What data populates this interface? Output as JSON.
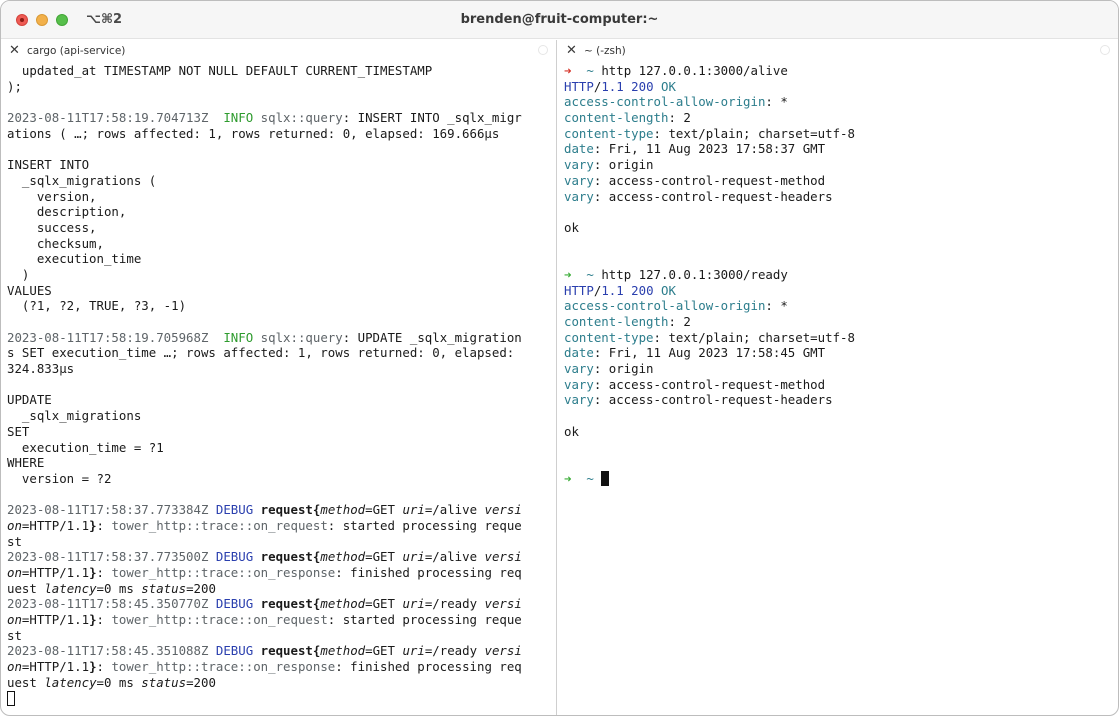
{
  "window": {
    "shortcut": "⌥⌘2",
    "title": "brenden@fruit-computer:~"
  },
  "left_pane": {
    "tab_label": "cargo (api-service)",
    "lines": [
      [
        {
          "t": "  updated_at TIMESTAMP NOT NULL DEFAULT CURRENT_TIMESTAMP"
        }
      ],
      [
        {
          "t": ");"
        }
      ],
      [
        {
          "t": ""
        }
      ],
      [
        {
          "t": "2023-08-11T17:58:19.704713Z",
          "c": "grey"
        },
        {
          "t": "  "
        },
        {
          "t": "INFO",
          "c": "green"
        },
        {
          "t": " "
        },
        {
          "t": "sqlx::query",
          "c": "grey"
        },
        {
          "t": ": INSERT INTO _sqlx_migr"
        }
      ],
      [
        {
          "t": "ations ( …; rows affected: 1, rows returned: 0, elapsed: 169.666µs"
        }
      ],
      [
        {
          "t": ""
        }
      ],
      [
        {
          "t": "INSERT INTO"
        }
      ],
      [
        {
          "t": "  _sqlx_migrations ("
        }
      ],
      [
        {
          "t": "    version,"
        }
      ],
      [
        {
          "t": "    description,"
        }
      ],
      [
        {
          "t": "    success,"
        }
      ],
      [
        {
          "t": "    checksum,"
        }
      ],
      [
        {
          "t": "    execution_time"
        }
      ],
      [
        {
          "t": "  )"
        }
      ],
      [
        {
          "t": "VALUES"
        }
      ],
      [
        {
          "t": "  (?1, ?2, TRUE, ?3, -1)"
        }
      ],
      [
        {
          "t": ""
        }
      ],
      [
        {
          "t": "2023-08-11T17:58:19.705968Z",
          "c": "grey"
        },
        {
          "t": "  "
        },
        {
          "t": "INFO",
          "c": "green"
        },
        {
          "t": " "
        },
        {
          "t": "sqlx::query",
          "c": "grey"
        },
        {
          "t": ": UPDATE _sqlx_migration"
        }
      ],
      [
        {
          "t": "s SET execution_time …; rows affected: 1, rows returned: 0, elapsed:"
        }
      ],
      [
        {
          "t": "324.833µs"
        }
      ],
      [
        {
          "t": ""
        }
      ],
      [
        {
          "t": "UPDATE"
        }
      ],
      [
        {
          "t": "  _sqlx_migrations"
        }
      ],
      [
        {
          "t": "SET"
        }
      ],
      [
        {
          "t": "  execution_time = ?1"
        }
      ],
      [
        {
          "t": "WHERE"
        }
      ],
      [
        {
          "t": "  version = ?2"
        }
      ],
      [
        {
          "t": ""
        }
      ],
      [
        {
          "t": "2023-08-11T17:58:37.773384Z",
          "c": "grey"
        },
        {
          "t": " "
        },
        {
          "t": "DEBUG",
          "c": "blue"
        },
        {
          "t": " "
        },
        {
          "t": "request{",
          "c": "bold"
        },
        {
          "t": "method",
          "c": "ital"
        },
        {
          "t": "=GET "
        },
        {
          "t": "uri",
          "c": "ital"
        },
        {
          "t": "=/alive "
        },
        {
          "t": "versi",
          "c": "ital"
        }
      ],
      [
        {
          "t": "on",
          "c": "ital"
        },
        {
          "t": "=HTTP/1.1"
        },
        {
          "t": "}",
          "c": "bold"
        },
        {
          "t": ": "
        },
        {
          "t": "tower_http::trace::on_request",
          "c": "grey"
        },
        {
          "t": ": started processing reque"
        }
      ],
      [
        {
          "t": "st"
        }
      ],
      [
        {
          "t": "2023-08-11T17:58:37.773500Z",
          "c": "grey"
        },
        {
          "t": " "
        },
        {
          "t": "DEBUG",
          "c": "blue"
        },
        {
          "t": " "
        },
        {
          "t": "request{",
          "c": "bold"
        },
        {
          "t": "method",
          "c": "ital"
        },
        {
          "t": "=GET "
        },
        {
          "t": "uri",
          "c": "ital"
        },
        {
          "t": "=/alive "
        },
        {
          "t": "versi",
          "c": "ital"
        }
      ],
      [
        {
          "t": "on",
          "c": "ital"
        },
        {
          "t": "=HTTP/1.1"
        },
        {
          "t": "}",
          "c": "bold"
        },
        {
          "t": ": "
        },
        {
          "t": "tower_http::trace::on_response",
          "c": "grey"
        },
        {
          "t": ": finished processing req"
        }
      ],
      [
        {
          "t": "uest "
        },
        {
          "t": "latency",
          "c": "ital"
        },
        {
          "t": "=0 ms "
        },
        {
          "t": "status",
          "c": "ital"
        },
        {
          "t": "=200"
        }
      ],
      [
        {
          "t": "2023-08-11T17:58:45.350770Z",
          "c": "grey"
        },
        {
          "t": " "
        },
        {
          "t": "DEBUG",
          "c": "blue"
        },
        {
          "t": " "
        },
        {
          "t": "request{",
          "c": "bold"
        },
        {
          "t": "method",
          "c": "ital"
        },
        {
          "t": "=GET "
        },
        {
          "t": "uri",
          "c": "ital"
        },
        {
          "t": "=/ready "
        },
        {
          "t": "versi",
          "c": "ital"
        }
      ],
      [
        {
          "t": "on",
          "c": "ital"
        },
        {
          "t": "=HTTP/1.1"
        },
        {
          "t": "}",
          "c": "bold"
        },
        {
          "t": ": "
        },
        {
          "t": "tower_http::trace::on_request",
          "c": "grey"
        },
        {
          "t": ": started processing reque"
        }
      ],
      [
        {
          "t": "st"
        }
      ],
      [
        {
          "t": "2023-08-11T17:58:45.351088Z",
          "c": "grey"
        },
        {
          "t": " "
        },
        {
          "t": "DEBUG",
          "c": "blue"
        },
        {
          "t": " "
        },
        {
          "t": "request{",
          "c": "bold"
        },
        {
          "t": "method",
          "c": "ital"
        },
        {
          "t": "=GET "
        },
        {
          "t": "uri",
          "c": "ital"
        },
        {
          "t": "=/ready "
        },
        {
          "t": "versi",
          "c": "ital"
        }
      ],
      [
        {
          "t": "on",
          "c": "ital"
        },
        {
          "t": "=HTTP/1.1"
        },
        {
          "t": "}",
          "c": "bold"
        },
        {
          "t": ": "
        },
        {
          "t": "tower_http::trace::on_response",
          "c": "grey"
        },
        {
          "t": ": finished processing req"
        }
      ],
      [
        {
          "t": "uest "
        },
        {
          "t": "latency",
          "c": "ital"
        },
        {
          "t": "=0 ms "
        },
        {
          "t": "status",
          "c": "ital"
        },
        {
          "t": "=200"
        }
      ],
      [
        {
          "cursor": "hollow"
        }
      ]
    ]
  },
  "right_pane": {
    "tab_label": "~ (-zsh)",
    "lines": [
      [
        {
          "t": "➜",
          "c": "arrow-red"
        },
        {
          "t": "  "
        },
        {
          "t": "~",
          "c": "teal"
        },
        {
          "t": " http 127.0.0.1:3000/alive"
        }
      ],
      [
        {
          "t": "HTTP",
          "c": "blue"
        },
        {
          "t": "/"
        },
        {
          "t": "1.1",
          "c": "blue"
        },
        {
          "t": " "
        },
        {
          "t": "200",
          "c": "blue"
        },
        {
          "t": " "
        },
        {
          "t": "OK",
          "c": "teal"
        }
      ],
      [
        {
          "t": "access-control-allow-origin",
          "c": "teal"
        },
        {
          "t": ": *"
        }
      ],
      [
        {
          "t": "content-length",
          "c": "teal"
        },
        {
          "t": ": 2"
        }
      ],
      [
        {
          "t": "content-type",
          "c": "teal"
        },
        {
          "t": ": text/plain; charset=utf-8"
        }
      ],
      [
        {
          "t": "date",
          "c": "teal"
        },
        {
          "t": ": Fri, 11 Aug 2023 17:58:37 GMT"
        }
      ],
      [
        {
          "t": "vary",
          "c": "teal"
        },
        {
          "t": ": origin"
        }
      ],
      [
        {
          "t": "vary",
          "c": "teal"
        },
        {
          "t": ": access-control-request-method"
        }
      ],
      [
        {
          "t": "vary",
          "c": "teal"
        },
        {
          "t": ": access-control-request-headers"
        }
      ],
      [
        {
          "t": ""
        }
      ],
      [
        {
          "t": "ok"
        }
      ],
      [
        {
          "t": ""
        }
      ],
      [
        {
          "t": ""
        }
      ],
      [
        {
          "t": "➜",
          "c": "arrow-green"
        },
        {
          "t": "  "
        },
        {
          "t": "~",
          "c": "teal"
        },
        {
          "t": " http 127.0.0.1:3000/ready"
        }
      ],
      [
        {
          "t": "HTTP",
          "c": "blue"
        },
        {
          "t": "/"
        },
        {
          "t": "1.1",
          "c": "blue"
        },
        {
          "t": " "
        },
        {
          "t": "200",
          "c": "blue"
        },
        {
          "t": " "
        },
        {
          "t": "OK",
          "c": "teal"
        }
      ],
      [
        {
          "t": "access-control-allow-origin",
          "c": "teal"
        },
        {
          "t": ": *"
        }
      ],
      [
        {
          "t": "content-length",
          "c": "teal"
        },
        {
          "t": ": 2"
        }
      ],
      [
        {
          "t": "content-type",
          "c": "teal"
        },
        {
          "t": ": text/plain; charset=utf-8"
        }
      ],
      [
        {
          "t": "date",
          "c": "teal"
        },
        {
          "t": ": Fri, 11 Aug 2023 17:58:45 GMT"
        }
      ],
      [
        {
          "t": "vary",
          "c": "teal"
        },
        {
          "t": ": origin"
        }
      ],
      [
        {
          "t": "vary",
          "c": "teal"
        },
        {
          "t": ": access-control-request-method"
        }
      ],
      [
        {
          "t": "vary",
          "c": "teal"
        },
        {
          "t": ": access-control-request-headers"
        }
      ],
      [
        {
          "t": ""
        }
      ],
      [
        {
          "t": "ok"
        }
      ],
      [
        {
          "t": ""
        }
      ],
      [
        {
          "t": ""
        }
      ],
      [
        {
          "t": "➜",
          "c": "arrow-green"
        },
        {
          "t": "  "
        },
        {
          "t": "~",
          "c": "teal"
        },
        {
          "t": " "
        },
        {
          "cursor": "block"
        }
      ]
    ]
  },
  "colors": {
    "timestamp_grey": "#5e6468",
    "info_green": "#2e9b2e",
    "debug_blue": "#2a3fae",
    "header_teal": "#2c7d8c",
    "error_arrow_red": "#d6362b",
    "ok_arrow_green": "#3eae3b"
  },
  "icons": {
    "close_tab": "close-icon",
    "traffic_close": "close-window-icon",
    "traffic_min": "minimize-window-icon",
    "traffic_max": "maximize-window-icon"
  }
}
